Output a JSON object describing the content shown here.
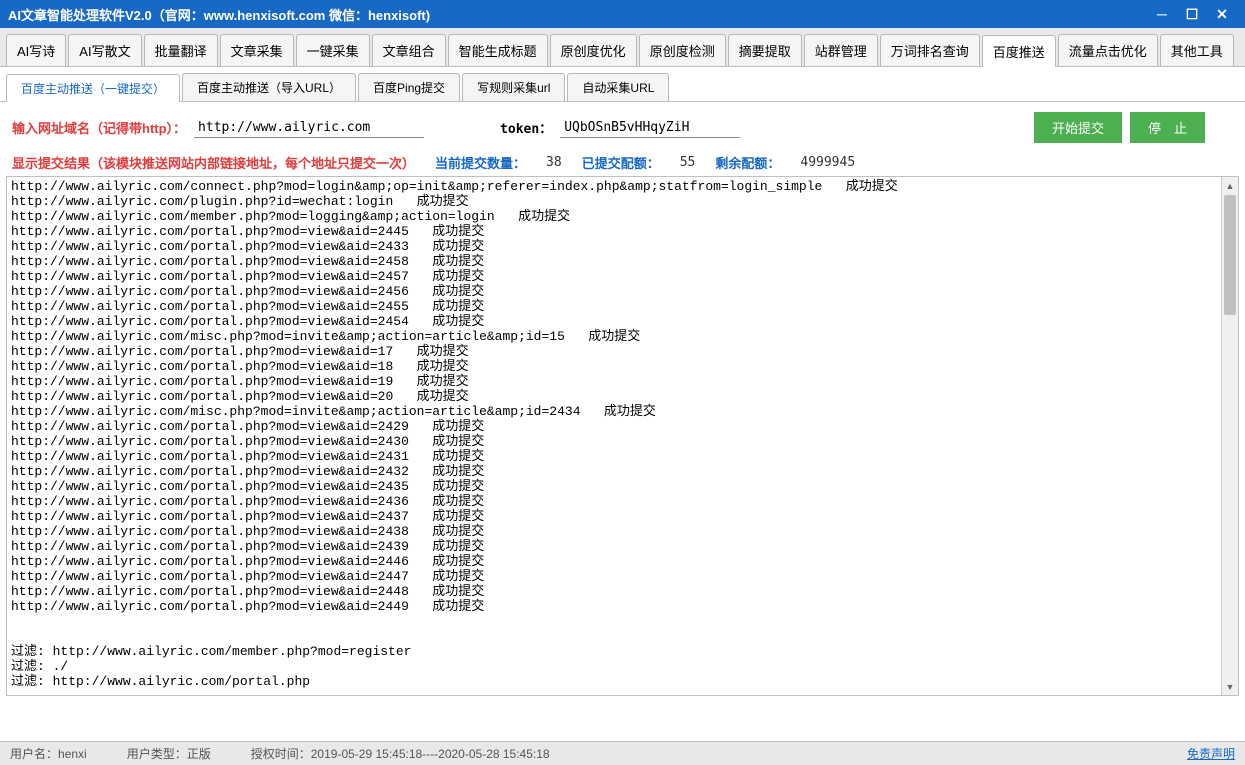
{
  "window": {
    "title": "AI文章智能处理软件V2.0（官网：www.henxisoft.com  微信：henxisoft)"
  },
  "mainTabs": [
    "AI写诗",
    "AI写散文",
    "批量翻译",
    "文章采集",
    "一键采集",
    "文章组合",
    "智能生成标题",
    "原创度优化",
    "原创度检测",
    "摘要提取",
    "站群管理",
    "万词排名查询",
    "百度推送",
    "流量点击优化",
    "其他工具"
  ],
  "mainTabActive": 12,
  "subTabs": [
    "百度主动推送（一键提交）",
    "百度主动推送（导入URL）",
    "百度Ping提交",
    "写规则采集url",
    "自动采集URL"
  ],
  "subTabActive": 0,
  "form": {
    "domainLabel": "输入网址域名（记得带http）：",
    "domainValue": "http://www.ailyric.com",
    "tokenLabel": "token：",
    "tokenValue": "UQbOSnB5vHHqyZiH",
    "startBtn": "开始提交",
    "stopBtn": "停　止"
  },
  "results": {
    "title": "显示提交结果（该模块推送网站内部链接地址，每个地址只提交一次）",
    "currentLabel": "当前提交数量：",
    "currentValue": "38",
    "submittedLabel": "已提交配额：",
    "submittedValue": "55",
    "remainLabel": "剩余配额：",
    "remainValue": "4999945"
  },
  "log": "http://www.ailyric.com/connect.php?mod=login&amp;op=init&amp;referer=index.php&amp;statfrom=login_simple   成功提交\nhttp://www.ailyric.com/plugin.php?id=wechat:login   成功提交\nhttp://www.ailyric.com/member.php?mod=logging&amp;action=login   成功提交\nhttp://www.ailyric.com/portal.php?mod=view&aid=2445   成功提交\nhttp://www.ailyric.com/portal.php?mod=view&aid=2433   成功提交\nhttp://www.ailyric.com/portal.php?mod=view&aid=2458   成功提交\nhttp://www.ailyric.com/portal.php?mod=view&aid=2457   成功提交\nhttp://www.ailyric.com/portal.php?mod=view&aid=2456   成功提交\nhttp://www.ailyric.com/portal.php?mod=view&aid=2455   成功提交\nhttp://www.ailyric.com/portal.php?mod=view&aid=2454   成功提交\nhttp://www.ailyric.com/misc.php?mod=invite&amp;action=article&amp;id=15   成功提交\nhttp://www.ailyric.com/portal.php?mod=view&aid=17   成功提交\nhttp://www.ailyric.com/portal.php?mod=view&aid=18   成功提交\nhttp://www.ailyric.com/portal.php?mod=view&aid=19   成功提交\nhttp://www.ailyric.com/portal.php?mod=view&aid=20   成功提交\nhttp://www.ailyric.com/misc.php?mod=invite&amp;action=article&amp;id=2434   成功提交\nhttp://www.ailyric.com/portal.php?mod=view&aid=2429   成功提交\nhttp://www.ailyric.com/portal.php?mod=view&aid=2430   成功提交\nhttp://www.ailyric.com/portal.php?mod=view&aid=2431   成功提交\nhttp://www.ailyric.com/portal.php?mod=view&aid=2432   成功提交\nhttp://www.ailyric.com/portal.php?mod=view&aid=2435   成功提交\nhttp://www.ailyric.com/portal.php?mod=view&aid=2436   成功提交\nhttp://www.ailyric.com/portal.php?mod=view&aid=2437   成功提交\nhttp://www.ailyric.com/portal.php?mod=view&aid=2438   成功提交\nhttp://www.ailyric.com/portal.php?mod=view&aid=2439   成功提交\nhttp://www.ailyric.com/portal.php?mod=view&aid=2446   成功提交\nhttp://www.ailyric.com/portal.php?mod=view&aid=2447   成功提交\nhttp://www.ailyric.com/portal.php?mod=view&aid=2448   成功提交\nhttp://www.ailyric.com/portal.php?mod=view&aid=2449   成功提交\n\n\n过滤: http://www.ailyric.com/member.php?mod=register\n过滤: ./\n过滤: http://www.ailyric.com/portal.php",
  "status": {
    "userLabel": "用户名：",
    "userValue": "henxi",
    "typeLabel": "用户类型：",
    "typeValue": "正版",
    "authLabel": "授权时间：",
    "authValue": "2019-05-29 15:45:18----2020-05-28 15:45:18",
    "disclaimer": "免责声明"
  }
}
